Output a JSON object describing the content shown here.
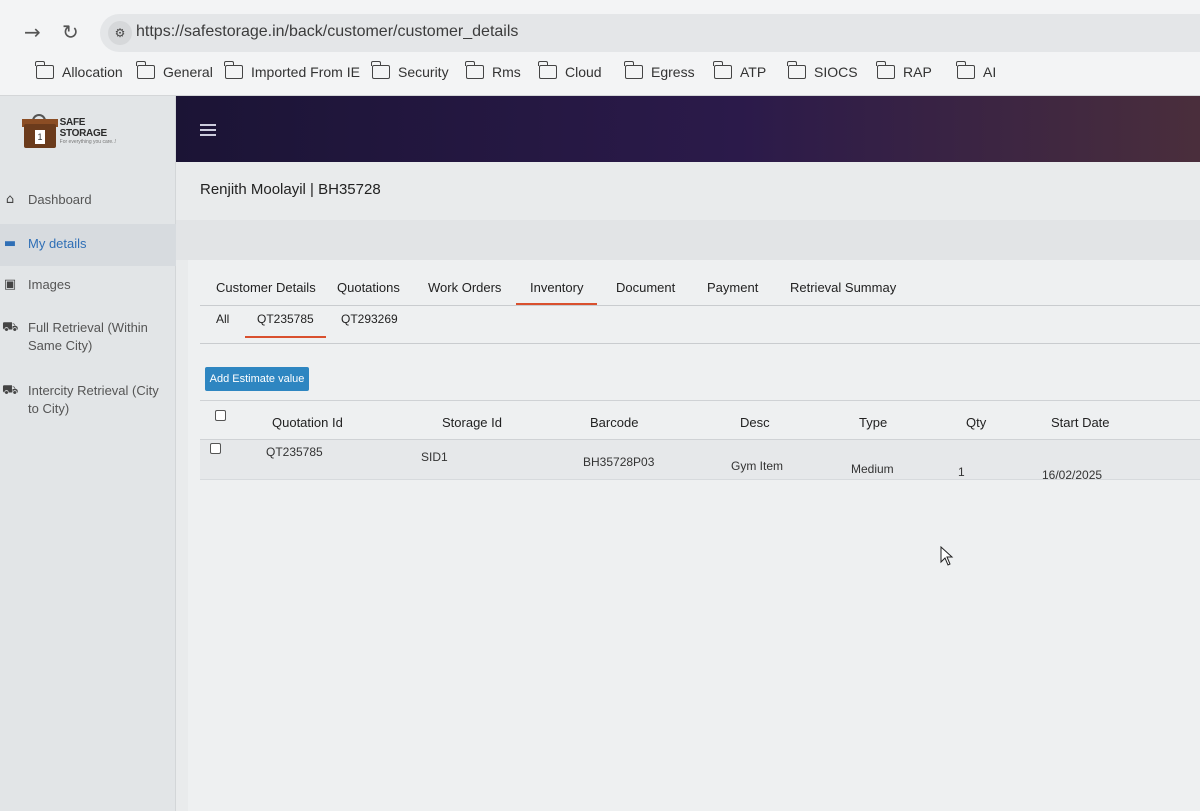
{
  "browser": {
    "url": "https://safestorage.in/back/customer/customer_details",
    "bookmarks": [
      "Allocation",
      "General",
      "Imported From IE",
      "Security",
      "Rms",
      "Cloud",
      "Egress",
      "ATP",
      "SIOCS",
      "RAP",
      "AI"
    ]
  },
  "logo": {
    "title": "SAFE STORAGE",
    "tagline": "For everything you care..!",
    "box_number": "1"
  },
  "sidebar": {
    "items": [
      {
        "label": "Dashboard",
        "icon": "home-icon"
      },
      {
        "label": "My details",
        "icon": "id-card-icon"
      },
      {
        "label": "Images",
        "icon": "image-icon"
      },
      {
        "label": "Full Retrieval (Within Same City)",
        "icon": "cart-icon"
      },
      {
        "label": "Intercity Retrieval (City to City)",
        "icon": "truck-icon"
      }
    ]
  },
  "customer": {
    "title": "Renjith Moolayil | BH35728"
  },
  "tabs": [
    "Customer Details",
    "Quotations",
    "Work Orders",
    "Inventory",
    "Document",
    "Payment",
    "Retrieval Summay"
  ],
  "active_tab": "Inventory",
  "sub_tabs": [
    "All",
    "QT235785",
    "QT293269"
  ],
  "active_sub_tab": "QT235785",
  "add_button": "Add Estimate value",
  "table": {
    "headers": [
      "Quotation Id",
      "Storage Id",
      "Barcode",
      "Desc",
      "Type",
      "Qty",
      "Start Date"
    ],
    "rows": [
      [
        "QT235785",
        "SID1",
        "BH35728P03",
        "Gym Item",
        "Medium",
        "1",
        "16/02/2025"
      ]
    ]
  },
  "colors": {
    "header_dark": "#1b1435",
    "accent_tab": "#d9502e",
    "button_blue": "#2e86c1",
    "active_link": "#2f6fb6"
  }
}
